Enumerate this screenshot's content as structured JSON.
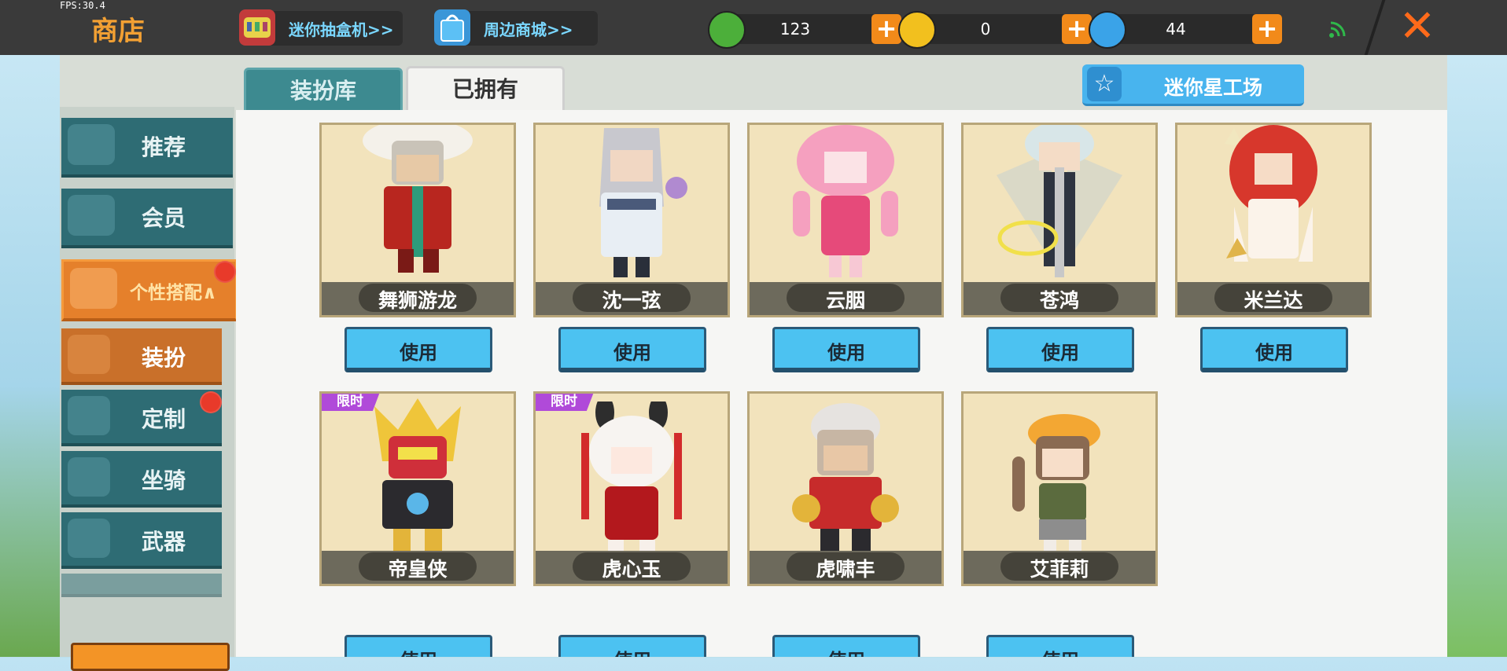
{
  "fps": "FPS:30.4",
  "header": {
    "title": "商店",
    "links": [
      {
        "label": "迷你抽盒机>>",
        "icon": "gacha-machine-icon"
      },
      {
        "label": "周边商城>>",
        "icon": "shopping-bag-icon"
      }
    ],
    "currencies": [
      {
        "name": "mini-bean",
        "amount": "123",
        "color": "#4caf3a"
      },
      {
        "name": "mini-coin",
        "amount": "0",
        "color": "#f2c01e"
      },
      {
        "name": "mini-point",
        "amount": "44",
        "color": "#3aa3e8"
      }
    ],
    "close_icon": "close-icon"
  },
  "tabs": [
    {
      "label": "装扮库",
      "active": false
    },
    {
      "label": "已拥有",
      "active": true
    }
  ],
  "studio_button": {
    "label": "迷你星工场"
  },
  "sidebar": {
    "items": [
      {
        "label": "推荐"
      },
      {
        "label": "会员"
      },
      {
        "label": "个性搭配∧",
        "badge": true
      }
    ],
    "subitems": [
      {
        "label": "装扮",
        "selected": true
      },
      {
        "label": "定制",
        "badge": true
      },
      {
        "label": "坐骑"
      },
      {
        "label": "武器"
      }
    ]
  },
  "skins": [
    {
      "name": "舞狮游龙",
      "button": "使用"
    },
    {
      "name": "沈一弦",
      "button": "使用"
    },
    {
      "name": "云胭",
      "button": "使用"
    },
    {
      "name": "苍鸿",
      "button": "使用"
    },
    {
      "name": "米兰达",
      "button": "使用"
    },
    {
      "name": "帝皇侠",
      "button": "使用",
      "tag": "限时"
    },
    {
      "name": "虎心玉",
      "button": "使用",
      "tag": "限时"
    },
    {
      "name": "虎啸丰",
      "button": "使用"
    },
    {
      "name": "艾菲莉",
      "button": "使用"
    }
  ]
}
